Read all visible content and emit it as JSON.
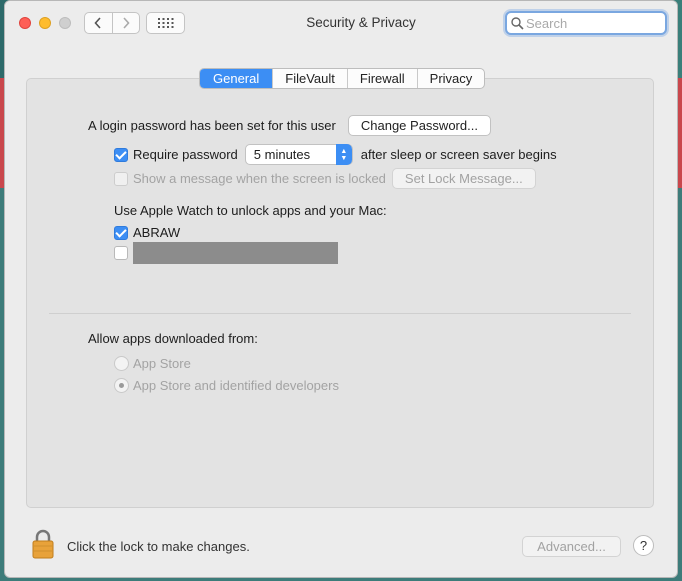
{
  "window": {
    "title": "Security & Privacy"
  },
  "toolbar": {
    "back_icon": "chevron-left-icon",
    "forward_icon": "chevron-right-icon",
    "grid_icon": "grid-icon"
  },
  "search": {
    "placeholder": "Search",
    "value": ""
  },
  "tabs": [
    {
      "label": "General",
      "active": true
    },
    {
      "label": "FileVault",
      "active": false
    },
    {
      "label": "Firewall",
      "active": false
    },
    {
      "label": "Privacy",
      "active": false
    }
  ],
  "general": {
    "login_text": "A login password has been set for this user",
    "change_password_label": "Change Password...",
    "require_password_label": "Require password",
    "require_password_checked": true,
    "require_password_delay": "5 minutes",
    "after_sleep_text": "after sleep or screen saver begins",
    "show_message_label": "Show a message when the screen is locked",
    "show_message_checked": false,
    "set_lock_message_label": "Set Lock Message...",
    "apple_watch_heading": "Use Apple Watch to unlock apps and your Mac:",
    "watches": [
      {
        "name": "ABRAW",
        "checked": true
      },
      {
        "name": "",
        "checked": false,
        "redacted": true
      }
    ],
    "allow_apps_heading": "Allow apps downloaded from:",
    "allow_options": [
      {
        "label": "App Store",
        "selected": false
      },
      {
        "label": "App Store and identified developers",
        "selected": true
      }
    ]
  },
  "footer": {
    "lock_text": "Click the lock to make changes.",
    "advanced_label": "Advanced...",
    "help_label": "?"
  },
  "colors": {
    "accent": "#3c8ef4",
    "window_bg": "#ececec",
    "panel_bg": "#e3e3e3"
  }
}
